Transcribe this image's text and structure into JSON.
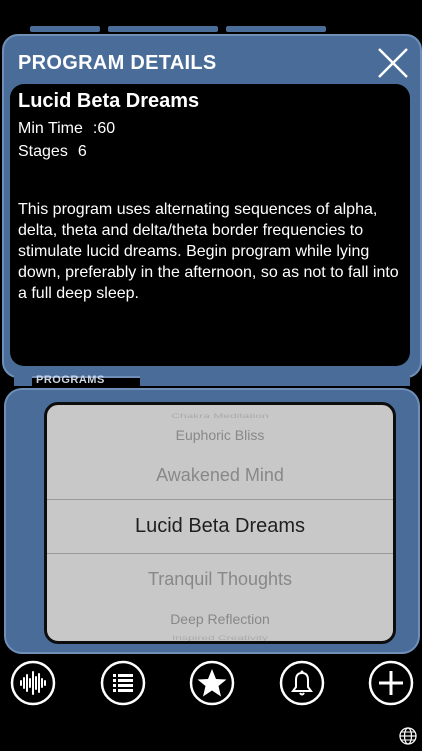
{
  "panel": {
    "title": "PROGRAM DETAILS"
  },
  "program": {
    "name": "Lucid Beta Dreams",
    "min_time_label": "Min Time",
    "min_time_value": ":60",
    "stages_label": "Stages",
    "stages_value": "6",
    "description": "This program uses alternating sequences of alpha, delta, theta and delta/theta border frequencies to stimulate lucid dreams.  Begin program while lying down, preferably in the afternoon, so as not to fall into a full deep sleep."
  },
  "programs_section": {
    "label": "PROGRAMS",
    "items": [
      "Chakra Meditation",
      "Euphoric Bliss",
      "Awakened Mind",
      "Lucid Beta Dreams",
      "Tranquil Thoughts",
      "Deep Reflection",
      "Inspired Creativity"
    ],
    "selected": "Lucid Beta Dreams"
  },
  "toolbar": {
    "icons": [
      "waveform-icon",
      "list-icon",
      "star-icon",
      "bell-icon",
      "plus-icon"
    ]
  },
  "colors": {
    "accent": "#4a6c99",
    "accent_light": "#6f8fb9",
    "picker_bg": "#c8c8c8"
  }
}
